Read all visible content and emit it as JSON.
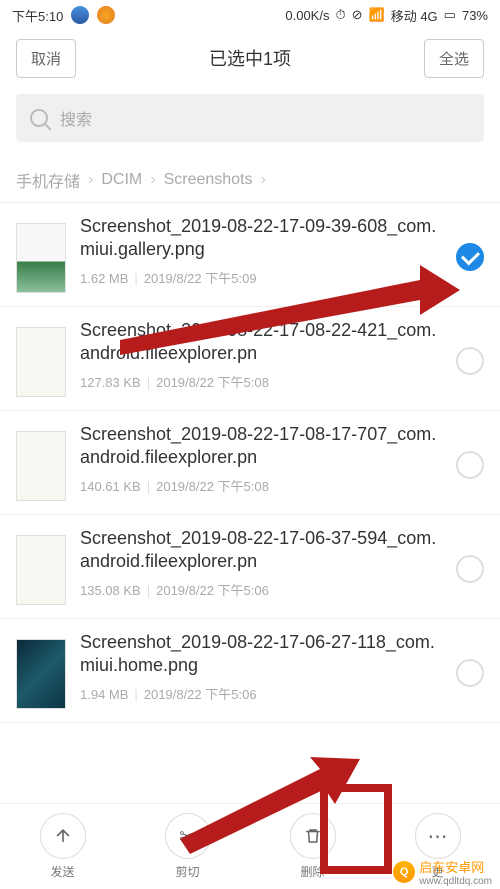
{
  "status": {
    "time": "下午5:10",
    "network_speed": "0.00K/s",
    "carrier": "移动 4G",
    "battery": "73%"
  },
  "nav": {
    "cancel": "取消",
    "title": "已选中1项",
    "select_all": "全选"
  },
  "search": {
    "placeholder": "搜索"
  },
  "breadcrumb": {
    "items": [
      "手机存储",
      "DCIM",
      "Screenshots"
    ]
  },
  "files": [
    {
      "name": "Screenshot_2019-08-22-17-09-39-608_com.miui.gallery.png",
      "size": "1.62 MB",
      "date": "2019/8/22 下午5:09",
      "selected": true,
      "thumb": "gallery"
    },
    {
      "name": "Screenshot_2019-08-22-17-08-22-421_com.android.fileexplorer.pn",
      "size": "127.83 KB",
      "date": "2019/8/22 下午5:08",
      "selected": false,
      "thumb": "explorer"
    },
    {
      "name": "Screenshot_2019-08-22-17-08-17-707_com.android.fileexplorer.pn",
      "size": "140.61 KB",
      "date": "2019/8/22 下午5:08",
      "selected": false,
      "thumb": "explorer"
    },
    {
      "name": "Screenshot_2019-08-22-17-06-37-594_com.android.fileexplorer.pn",
      "size": "135.08 KB",
      "date": "2019/8/22 下午5:06",
      "selected": false,
      "thumb": "explorer"
    },
    {
      "name": "Screenshot_2019-08-22-17-06-27-118_com.miui.home.png",
      "size": "1.94 MB",
      "date": "2019/8/22 下午5:06",
      "selected": false,
      "thumb": "home"
    }
  ],
  "bottom": {
    "send": "发送",
    "cut": "剪切",
    "delete": "删除",
    "more": "更"
  },
  "watermark": {
    "name": "启东安卓网",
    "url": "www.qdltdq.com"
  },
  "annotation_color": "#b71c1c"
}
